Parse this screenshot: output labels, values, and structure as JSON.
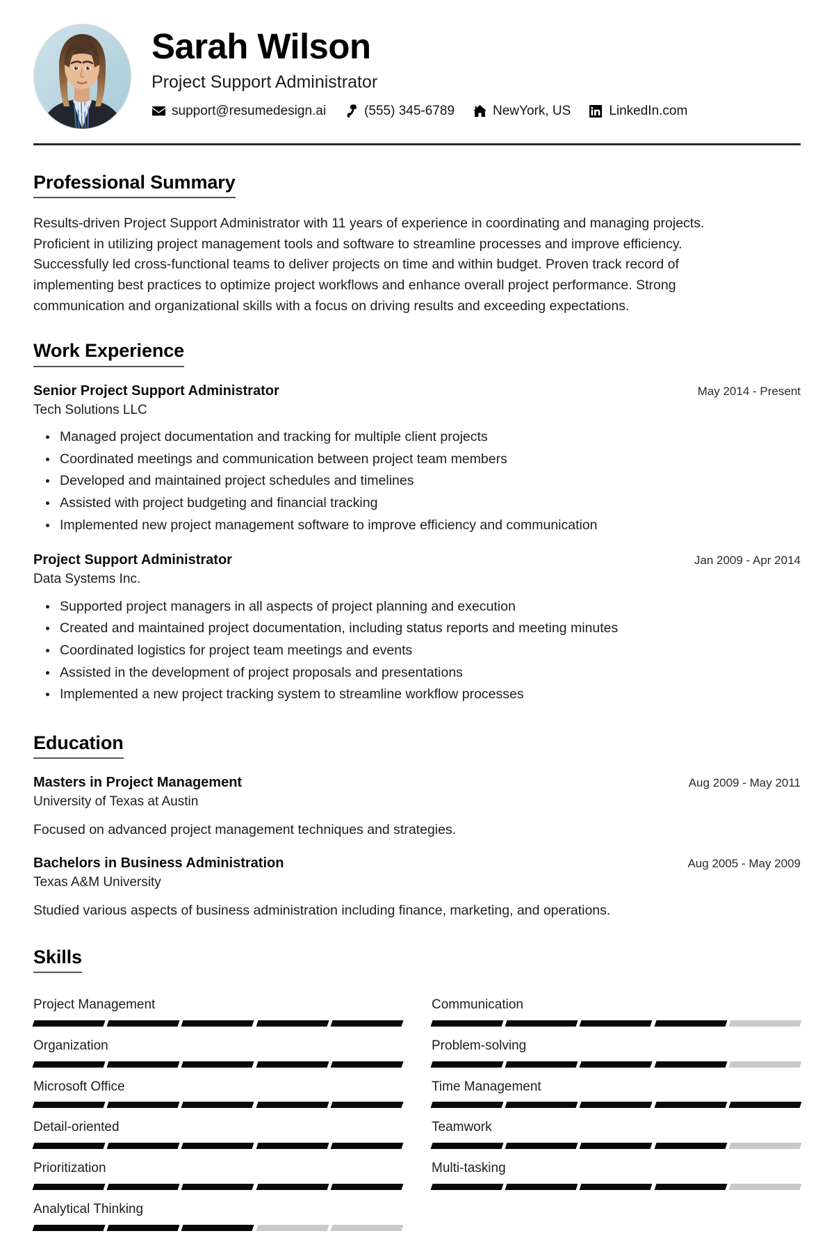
{
  "header": {
    "name": "Sarah Wilson",
    "job_title": "Project Support Administrator",
    "avatar_alt": "portrait-photo",
    "contacts": [
      {
        "icon": "envelope-icon",
        "name": "contact-email",
        "text": "support@resumedesign.ai"
      },
      {
        "icon": "phone-icon",
        "name": "contact-phone",
        "text": "(555) 345-6789"
      },
      {
        "icon": "home-icon",
        "name": "contact-location",
        "text": "NewYork, US"
      },
      {
        "icon": "linkedin-icon",
        "name": "contact-linkedin",
        "text": "LinkedIn.com"
      }
    ]
  },
  "summary": {
    "title": "Professional Summary",
    "text": "Results-driven Project Support Administrator with 11 years of experience in coordinating and managing projects. Proficient in utilizing project management tools and software to streamline processes and improve efficiency. Successfully led cross-functional teams to deliver projects on time and within budget. Proven track record of implementing best practices to optimize project workflows and enhance overall project performance. Strong communication and organizational skills with a focus on driving results and exceeding expectations."
  },
  "work": {
    "title": "Work Experience",
    "entries": [
      {
        "role": "Senior Project Support Administrator",
        "org": "Tech Solutions LLC",
        "date": "May 2014 - Present",
        "bullets": [
          "Managed project documentation and tracking for multiple client projects",
          "Coordinated meetings and communication between project team members",
          "Developed and maintained project schedules and timelines",
          "Assisted with project budgeting and financial tracking",
          "Implemented new project management software to improve efficiency and communication"
        ]
      },
      {
        "role": "Project Support Administrator",
        "org": "Data Systems Inc.",
        "date": "Jan 2009 - Apr 2014",
        "bullets": [
          "Supported project managers in all aspects of project planning and execution",
          "Created and maintained project documentation, including status reports and meeting minutes",
          "Coordinated logistics for project team meetings and events",
          "Assisted in the development of project proposals and presentations",
          "Implemented a new project tracking system to streamline workflow processes"
        ]
      }
    ]
  },
  "education": {
    "title": "Education",
    "entries": [
      {
        "degree": "Masters in Project Management",
        "school": "University of Texas at Austin",
        "date": "Aug 2009 - May 2011",
        "desc": "Focused on advanced project management techniques and strategies."
      },
      {
        "degree": "Bachelors in Business Administration",
        "school": "Texas A&M University",
        "date": "Aug 2005 - May 2009",
        "desc": "Studied various aspects of business administration including finance, marketing, and operations."
      }
    ]
  },
  "skills": {
    "title": "Skills",
    "segments_total": 5,
    "colors": {
      "filled": "#0a0a0a",
      "empty": "#c9c9c9"
    },
    "items": [
      {
        "name": "Project Management",
        "level": 5
      },
      {
        "name": "Communication",
        "level": 4
      },
      {
        "name": "Organization",
        "level": 5
      },
      {
        "name": "Problem-solving",
        "level": 4
      },
      {
        "name": "Microsoft Office",
        "level": 5
      },
      {
        "name": "Time Management",
        "level": 5
      },
      {
        "name": "Detail-oriented",
        "level": 5
      },
      {
        "name": "Teamwork",
        "level": 4
      },
      {
        "name": "Prioritization",
        "level": 5
      },
      {
        "name": "Multi-tasking",
        "level": 4
      },
      {
        "name": "Analytical Thinking",
        "level": 3
      }
    ]
  }
}
